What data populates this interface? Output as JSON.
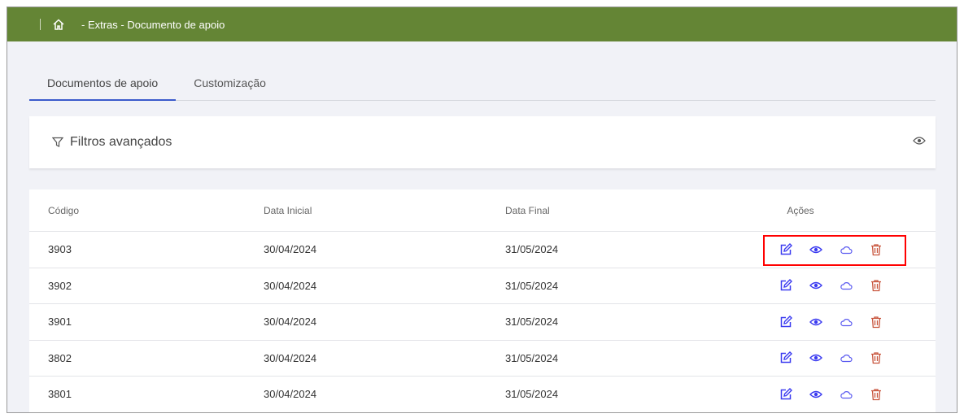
{
  "header": {
    "breadcrumb": "- Extras - Documento de apoio"
  },
  "tabs": [
    {
      "label": "Documentos de apoio"
    },
    {
      "label": "Customização"
    }
  ],
  "filters": {
    "title": "Filtros avançados"
  },
  "table": {
    "headers": [
      "Código",
      "Data Inicial",
      "Data Final",
      "Ações"
    ],
    "rows": [
      [
        "3903",
        "30/04/2024",
        "31/05/2024"
      ],
      [
        "3902",
        "30/04/2024",
        "31/05/2024"
      ],
      [
        "3901",
        "30/04/2024",
        "31/05/2024"
      ],
      [
        "3802",
        "30/04/2024",
        "31/05/2024"
      ],
      [
        "3801",
        "30/04/2024",
        "31/05/2024"
      ]
    ]
  },
  "colors": {
    "brand": "#648535",
    "action": "#3b3bf0",
    "delete": "#c8553d",
    "highlight": "#ff0000"
  }
}
